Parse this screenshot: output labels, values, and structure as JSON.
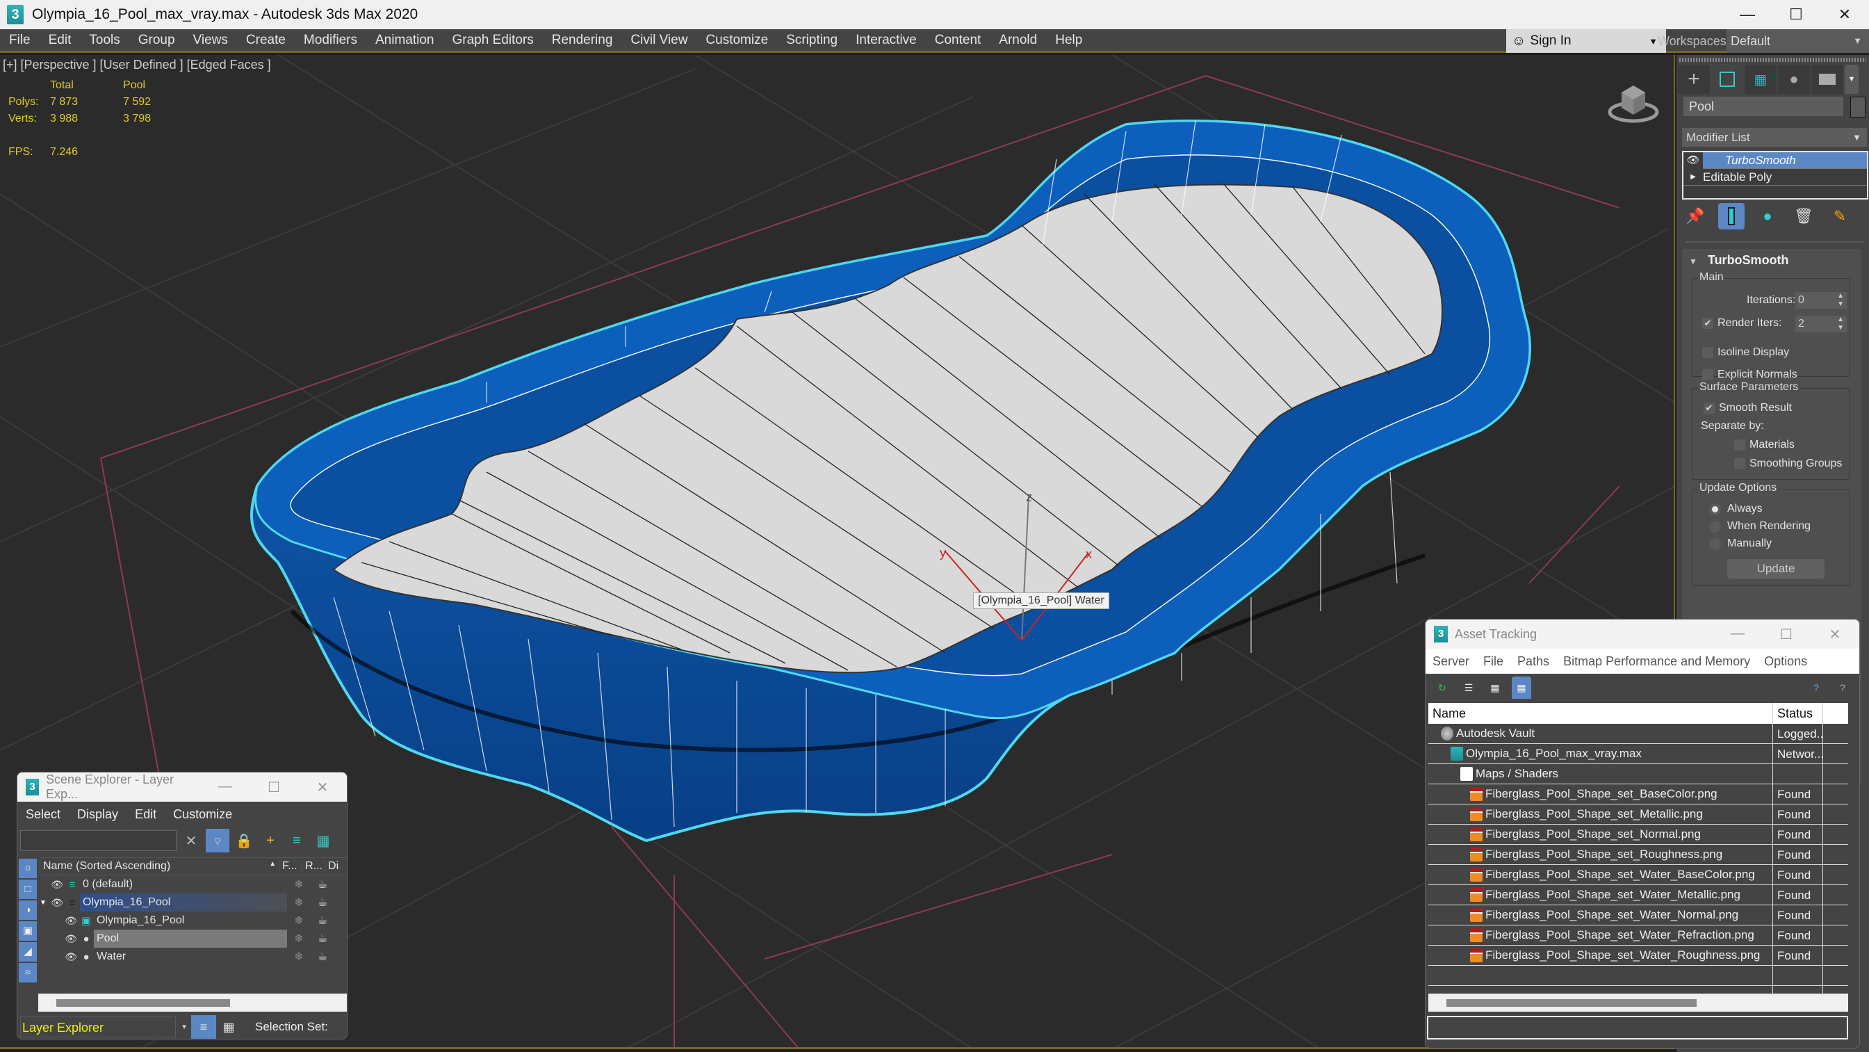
{
  "window": {
    "title": "Olympia_16_Pool_max_vray.max - Autodesk 3ds Max 2020",
    "app_icon": "3ds-max-logo-icon",
    "controls": {
      "minimize": "—",
      "maximize": "☐",
      "close": "✕"
    }
  },
  "menubar": {
    "items": [
      "File",
      "Edit",
      "Tools",
      "Group",
      "Views",
      "Create",
      "Modifiers",
      "Animation",
      "Graph Editors",
      "Rendering",
      "Civil View",
      "Customize",
      "Scripting",
      "Interactive",
      "Content",
      "Arnold",
      "Help"
    ],
    "sign_in": "Sign In",
    "workspaces_label": "Workspaces:",
    "workspace_value": "Default"
  },
  "viewport": {
    "label": "[+] [Perspective ] [User Defined ] [Edged Faces ]",
    "stats": {
      "headers": [
        "",
        "Total",
        "Pool"
      ],
      "polys_label": "Polys:",
      "polys_total": "7 873",
      "polys_selected": "7 592",
      "verts_label": "Verts:",
      "verts_total": "3 988",
      "verts_selected": "3 798",
      "fps_label": "FPS:",
      "fps_value": "7.246"
    },
    "tooltip": "[Olympia_16_Pool] Water",
    "gizmo": {
      "x": "x",
      "y": "y",
      "z": "z"
    },
    "colors": {
      "pool_shell": "#0a58b0",
      "water_surface": "#d8d8d8",
      "selection_outline": "#4fd8ef",
      "grid": "#3a3a3a",
      "stats_text": "#e3c92b"
    }
  },
  "command_panel": {
    "tabs": [
      "create-tab",
      "modify-tab",
      "hierarchy-tab",
      "motion-tab",
      "display-tab",
      "utilities-tab"
    ],
    "object_name": "Pool",
    "modifier_list": "Modifier List",
    "stack": [
      {
        "label": "TurboSmooth",
        "selected": true
      },
      {
        "label": "Editable Poly",
        "selected": false
      }
    ],
    "turbosmooth": {
      "title": "TurboSmooth",
      "main_group": "Main",
      "iterations_label": "Iterations:",
      "iterations_value": "0",
      "render_iters_label": "Render Iters:",
      "render_iters_value": "2",
      "render_iters_checked": true,
      "isoline_label": "Isoline Display",
      "explicit_normals_label": "Explicit Normals",
      "surface_group": "Surface Parameters",
      "smooth_result_label": "Smooth Result",
      "separate_by_label": "Separate by:",
      "materials_label": "Materials",
      "smoothing_groups_label": "Smoothing Groups",
      "update_group": "Update Options",
      "update_options": [
        "Always",
        "When Rendering",
        "Manually"
      ],
      "update_selected": "Always",
      "update_button": "Update"
    }
  },
  "scene_explorer": {
    "title": "Scene Explorer - Layer Exp...",
    "menu": [
      "Select",
      "Display",
      "Edit",
      "Customize"
    ],
    "search_value": "",
    "columns": {
      "name": "Name (Sorted Ascending)",
      "frozen": "F...",
      "render": "R...",
      "display": "Di"
    },
    "rows": [
      {
        "name": "0 (default)",
        "type": "layer",
        "indent": 0
      },
      {
        "name": "Olympia_16_Pool",
        "type": "layer",
        "indent": 0,
        "expanded": true,
        "selected": true
      },
      {
        "name": "Olympia_16_Pool",
        "type": "group",
        "indent": 1
      },
      {
        "name": "Pool",
        "type": "object",
        "indent": 1,
        "highlighted": true
      },
      {
        "name": "Water",
        "type": "object",
        "indent": 1
      }
    ],
    "explorer_mode": "Layer Explorer",
    "selection_set_label": "Selection Set:"
  },
  "asset_tracking": {
    "title": "Asset Tracking",
    "menu": [
      "Server",
      "File",
      "Paths",
      "Bitmap Performance and Memory",
      "Options"
    ],
    "columns": {
      "name": "Name",
      "status": "Status"
    },
    "rows": [
      {
        "name": "Autodesk Vault",
        "status": "Logged...",
        "indent": 0,
        "icon": "vault-icon"
      },
      {
        "name": "Olympia_16_Pool_max_vray.max",
        "status": "Networ...",
        "indent": 1,
        "icon": "max-file-icon"
      },
      {
        "name": "Maps / Shaders",
        "status": "",
        "indent": 2,
        "icon": "maps-folder-icon"
      },
      {
        "name": "Fiberglass_Pool_Shape_set_BaseColor.png",
        "status": "Found",
        "indent": 3,
        "icon": "png-file-icon"
      },
      {
        "name": "Fiberglass_Pool_Shape_set_Metallic.png",
        "status": "Found",
        "indent": 3,
        "icon": "png-file-icon"
      },
      {
        "name": "Fiberglass_Pool_Shape_set_Normal.png",
        "status": "Found",
        "indent": 3,
        "icon": "png-file-icon"
      },
      {
        "name": "Fiberglass_Pool_Shape_set_Roughness.png",
        "status": "Found",
        "indent": 3,
        "icon": "png-file-icon"
      },
      {
        "name": "Fiberglass_Pool_Shape_set_Water_BaseColor.png",
        "status": "Found",
        "indent": 3,
        "icon": "png-file-icon"
      },
      {
        "name": "Fiberglass_Pool_Shape_set_Water_Metallic.png",
        "status": "Found",
        "indent": 3,
        "icon": "png-file-icon"
      },
      {
        "name": "Fiberglass_Pool_Shape_set_Water_Normal.png",
        "status": "Found",
        "indent": 3,
        "icon": "png-file-icon"
      },
      {
        "name": "Fiberglass_Pool_Shape_set_Water_Refraction.png",
        "status": "Found",
        "indent": 3,
        "icon": "png-file-icon"
      },
      {
        "name": "Fiberglass_Pool_Shape_set_Water_Roughness.png",
        "status": "Found",
        "indent": 3,
        "icon": "png-file-icon"
      }
    ]
  }
}
